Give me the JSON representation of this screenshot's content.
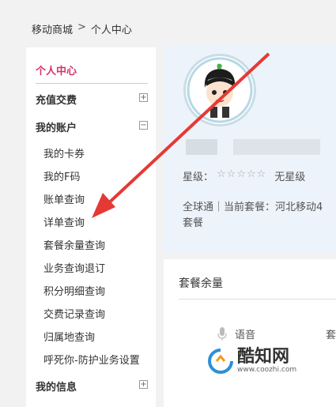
{
  "breadcrumb": {
    "root": "移动商城",
    "sep": ">",
    "current": "个人中心"
  },
  "sidebar": {
    "title": "个人中心",
    "sections": [
      {
        "label": "充值交费",
        "toggle": "+"
      },
      {
        "label": "我的账户",
        "toggle": "−"
      },
      {
        "label": "我的信息",
        "toggle": "+"
      }
    ],
    "account_items": [
      "我的卡券",
      "我的F码",
      "账单查询",
      "详单查询",
      "套餐余量查询",
      "业务查询退订",
      "积分明细查询",
      "交费记录查询",
      "归属地查询",
      "呼死你-防护业务设置"
    ]
  },
  "profile": {
    "level_label": "星级：",
    "stars": "☆☆☆☆☆",
    "level_value": "无星级",
    "plan_line1": "全球通｜当前套餐：河北移动4",
    "plan_line2": "套餐"
  },
  "balance": {
    "title": "套餐余量",
    "voice_label": "语音",
    "right_clip": "套"
  },
  "watermark": {
    "brand": "酷知网",
    "url": "www.coozhi.com"
  },
  "colors": {
    "accent": "#d6336c",
    "arrow": "#e53935"
  }
}
